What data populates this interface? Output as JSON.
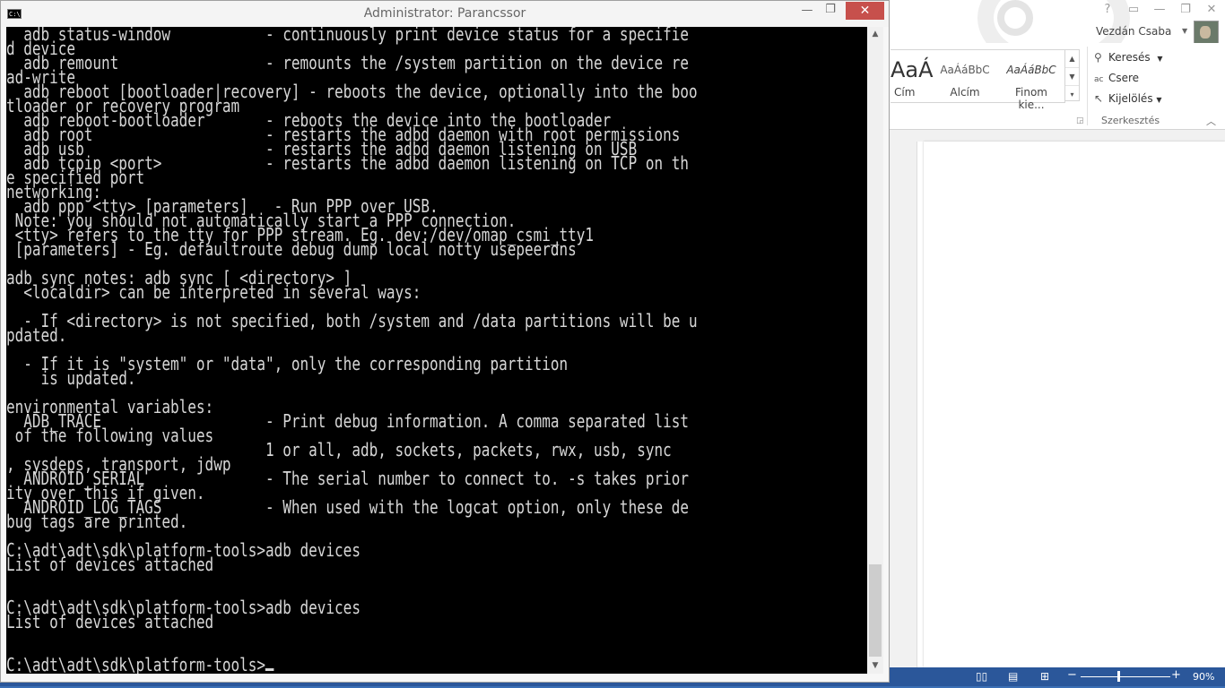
{
  "word": {
    "user_name": "Vezdán Csaba",
    "styles": [
      {
        "sample": "AaÁ",
        "name": "Cím"
      },
      {
        "sample": "AaÁáBbC",
        "name": "Alcím"
      },
      {
        "sample": "AaÁáBbC",
        "name": "Finom kie..."
      }
    ],
    "editing": {
      "find_label": "Keresés",
      "replace_label": "Csere",
      "select_label": "Kijelölés",
      "group_label": "Szerkesztés"
    },
    "zoom_level": "90%",
    "accent_color": "#2b579a"
  },
  "console": {
    "title": "Administrator: Parancssor",
    "icon_label": "C:\\",
    "lines": [
      "  adb status-window           - continuously print device status for a specifie",
      "d device",
      "  adb remount                 - remounts the /system partition on the device re",
      "ad-write",
      "  adb reboot [bootloader|recovery] - reboots the device, optionally into the boo",
      "tloader or recovery program",
      "  adb reboot-bootloader       - reboots the device into the bootloader",
      "  adb root                    - restarts the adbd daemon with root permissions",
      "  adb usb                     - restarts the adbd daemon listening on USB",
      "  adb tcpip <port>            - restarts the adbd daemon listening on TCP on th",
      "e specified port",
      "networking:",
      "  adb ppp <tty> [parameters]   - Run PPP over USB.",
      " Note: you should not automatically start a PPP connection.",
      " <tty> refers to the tty for PPP stream. Eg. dev:/dev/omap_csmi_tty1",
      " [parameters] - Eg. defaultroute debug dump local notty usepeerdns",
      "",
      "adb sync notes: adb sync [ <directory> ]",
      "  <localdir> can be interpreted in several ways:",
      "",
      "  - If <directory> is not specified, both /system and /data partitions will be u",
      "pdated.",
      "",
      "  - If it is \"system\" or \"data\", only the corresponding partition",
      "    is updated.",
      "",
      "environmental variables:",
      "  ADB_TRACE                   - Print debug information. A comma separated list",
      " of the following values",
      "                              1 or all, adb, sockets, packets, rwx, usb, sync",
      ", sysdeps, transport, jdwp",
      "  ANDROID_SERIAL              - The serial number to connect to. -s takes prior",
      "ity over this if given.",
      "  ANDROID_LOG_TAGS            - When used with the logcat option, only these de",
      "bug tags are printed.",
      "",
      "C:\\adt\\adt\\sdk\\platform-tools>adb devices",
      "List of devices attached",
      "",
      "",
      "C:\\adt\\adt\\sdk\\platform-tools>adb devices",
      "List of devices attached",
      "",
      "",
      "C:\\adt\\adt\\sdk\\platform-tools>"
    ],
    "text_color": "#d7d7d7",
    "background_color": "#000000"
  }
}
